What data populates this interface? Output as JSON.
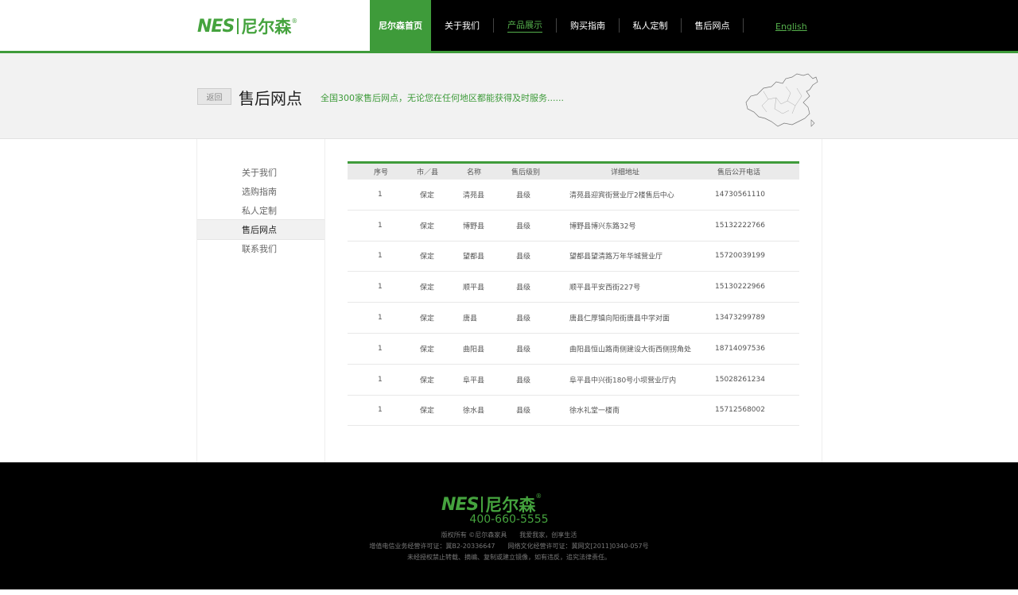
{
  "brand": {
    "logo_latin": "NES",
    "logo_cn": "尼尔森",
    "reg_mark": "®"
  },
  "nav": {
    "items": [
      {
        "label": "尼尔森首页"
      },
      {
        "label": "关于我们"
      },
      {
        "label": "产品展示"
      },
      {
        "label": "购买指南"
      },
      {
        "label": "私人定制"
      },
      {
        "label": "售后网点"
      }
    ],
    "english": "English"
  },
  "banner": {
    "back": "返回",
    "title": "售后网点",
    "subtitle": "全国300家售后网点，无论您在任何地区都能获得及时服务......",
    "map_icon": "china-map-icon"
  },
  "sidebar": {
    "items": [
      {
        "label": "关于我们"
      },
      {
        "label": "选购指南"
      },
      {
        "label": "私人定制"
      },
      {
        "label": "售后网点"
      },
      {
        "label": "联系我们"
      }
    ]
  },
  "table": {
    "headers": [
      "序号",
      "市／县",
      "名称",
      "售后级别",
      "详细地址",
      "售后公开电话"
    ],
    "rows": [
      [
        "1",
        "保定",
        "清苑县",
        "县级",
        "清苑县迎宾街营业厅2楼售后中心",
        "14730561110"
      ],
      [
        "1",
        "保定",
        "博野县",
        "县级",
        "博野县博兴东路32号",
        "15132222766"
      ],
      [
        "1",
        "保定",
        "望都县",
        "县级",
        "望都县望清路万年华城营业厅",
        "15720039199"
      ],
      [
        "1",
        "保定",
        "顺平县",
        "县级",
        "顺平县平安西街227号",
        "15130222966"
      ],
      [
        "1",
        "保定",
        "唐县",
        "县级",
        "唐县仁厚镇向阳街唐县中学对面",
        "13473299789"
      ],
      [
        "1",
        "保定",
        "曲阳县",
        "县级",
        "曲阳县恒山路南侧建设大街西侧拐角处",
        "18714097536"
      ],
      [
        "1",
        "保定",
        "阜平县",
        "县级",
        "阜平县中兴街180号小坝营业厅内",
        "15028261234"
      ],
      [
        "1",
        "保定",
        "徐水县",
        "县级",
        "徐水礼堂一楼南",
        "15712568002"
      ]
    ]
  },
  "footer": {
    "phone": "400-660-5555",
    "line1": "版权所有 ©尼尔森家具　　我爱我家，创享生活",
    "line2": "增值电信业务经营许可证：冀B2-20336647　　网络文化经营许可证：冀网文[2011]0340-057号",
    "line3": "未经授权禁止转载、摘编、复制或建立镜像，如有违反，追究法律责任。"
  },
  "colors": {
    "accent": "#3e9b3a",
    "header_bg": "#000000",
    "banner_bg": "#f2f2f2"
  }
}
